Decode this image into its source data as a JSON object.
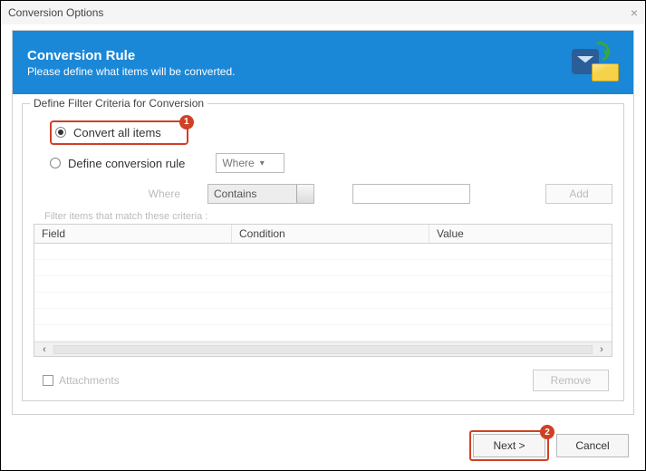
{
  "window": {
    "title": "Conversion Options"
  },
  "header": {
    "title": "Conversion Rule",
    "subtitle": "Please define what items will be converted."
  },
  "fieldset": {
    "legend": "Define Filter Criteria for Conversion",
    "option_convert_all": "Convert all items",
    "option_define_rule": "Define conversion rule",
    "where_dropdown": "Where",
    "where_label": "Where",
    "condition_dropdown": "Contains",
    "value_input": "",
    "add_button": "Add",
    "match_label": "Filter items that match these criteria :",
    "columns": {
      "field": "Field",
      "condition": "Condition",
      "value": "Value"
    },
    "attachments_label": "Attachments",
    "remove_button": "Remove"
  },
  "footer": {
    "next": "Next >",
    "cancel": "Cancel"
  },
  "badges": {
    "one": "1",
    "two": "2"
  }
}
